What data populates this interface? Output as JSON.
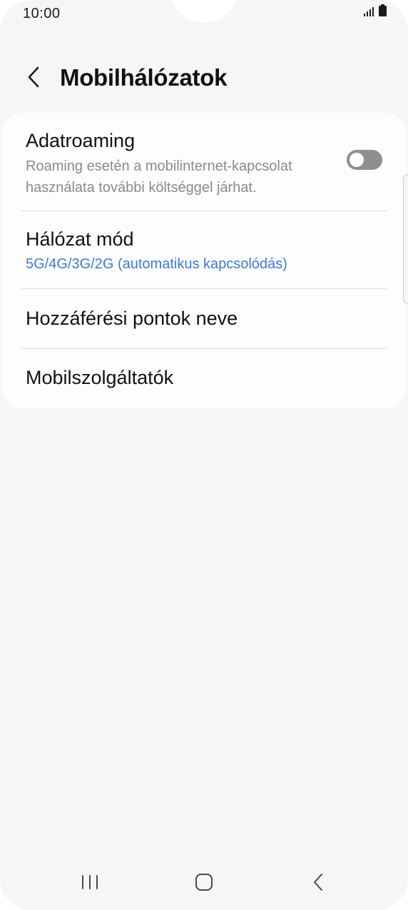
{
  "status_bar": {
    "time": "10:00",
    "icons": [
      "signal-icon",
      "battery-icon"
    ]
  },
  "header": {
    "back_icon": "chevron-left-icon",
    "title": "Mobilhálózatok"
  },
  "settings": {
    "data_roaming": {
      "title": "Adatroaming",
      "subtitle": "Roaming esetén a mobilinternet-kapcsolat használata további költséggel járhat.",
      "enabled": false
    },
    "network_mode": {
      "title": "Hálózat mód",
      "value": "5G/4G/3G/2G (automatikus kapcsolódás)"
    },
    "access_point_names": {
      "title": "Hozzáférési pontok neve"
    },
    "network_operators": {
      "title": "Mobilszolgáltatók"
    }
  },
  "colors": {
    "accent": "#3c7bd6",
    "background": "#f6f6f8",
    "card": "#fdfdfe",
    "toggle_off": "#8e8e93"
  },
  "nav_bar": {
    "icons": [
      "recent-apps-icon",
      "home-icon",
      "back-icon"
    ]
  }
}
